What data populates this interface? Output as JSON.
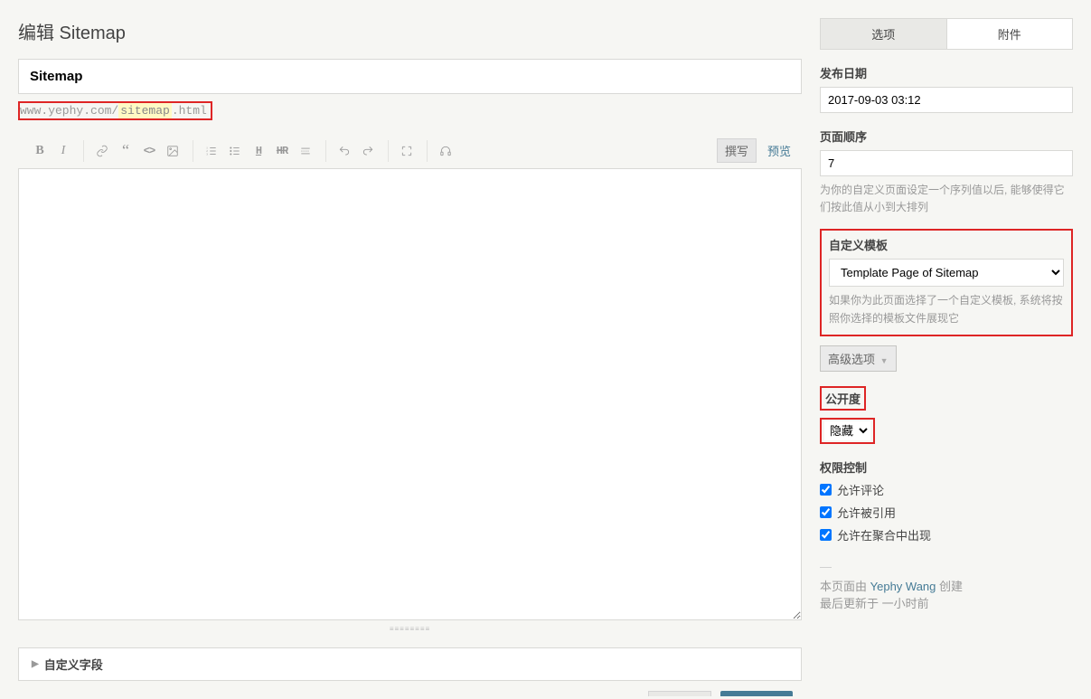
{
  "page_heading": "编辑 Sitemap",
  "title_value": "Sitemap",
  "url": {
    "domain": "www.yephy.com/",
    "slug": "sitemap",
    "ext": ".html"
  },
  "toolbar": {
    "write": "撰写",
    "preview": "预览"
  },
  "custom_fields_label": "自定义字段",
  "sidebar": {
    "tabs": {
      "options": "选项",
      "attachments": "附件"
    },
    "publish_date_label": "发布日期",
    "publish_date_value": "2017-09-03 03:12",
    "page_order_label": "页面顺序",
    "page_order_value": "7",
    "page_order_help": "为你的自定义页面设定一个序列值以后, 能够使得它们按此值从小到大排列",
    "template_label": "自定义模板",
    "template_value": "Template Page of Sitemap",
    "template_help": "如果你为此页面选择了一个自定义模板, 系统将按照你选择的模板文件展现它",
    "advanced_label": "高级选项",
    "visibility_label": "公开度",
    "visibility_value": "隐藏",
    "permission_label": "权限控制",
    "perm_comment": "允许评论",
    "perm_pingback": "允许被引用",
    "perm_aggregate": "允许在聚合中出现",
    "meta_created_prefix": "本页面由 ",
    "meta_author": "Yephy Wang",
    "meta_created_suffix": " 创建",
    "meta_updated": "最后更新于 一小时前"
  }
}
